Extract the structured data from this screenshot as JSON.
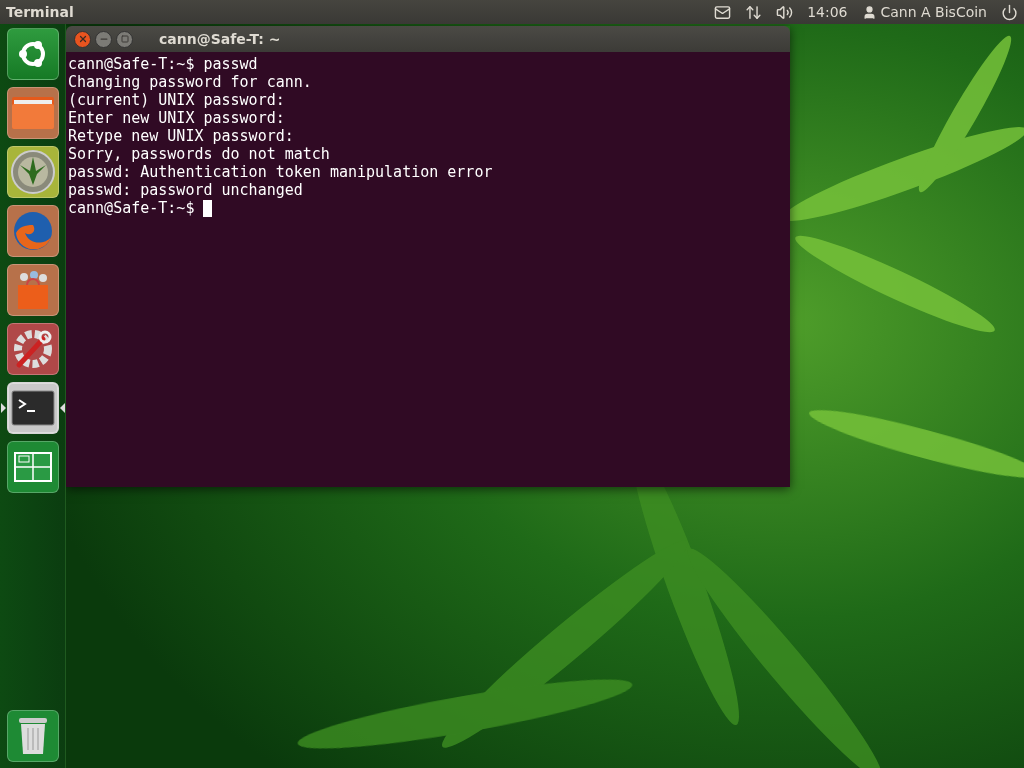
{
  "top_panel": {
    "app_title": "Terminal",
    "clock": "14:06",
    "user": "Cann A BisCoin"
  },
  "launcher": {
    "items": [
      {
        "kind": "ubuntu",
        "selected": false
      },
      {
        "kind": "files",
        "selected": false
      },
      {
        "kind": "coin",
        "selected": false
      },
      {
        "kind": "browser",
        "selected": false
      },
      {
        "kind": "store",
        "selected": false
      },
      {
        "kind": "settings",
        "selected": false
      },
      {
        "kind": "terminal",
        "selected": true
      },
      {
        "kind": "workspaces",
        "selected": false
      }
    ],
    "trash": {
      "kind": "trash"
    }
  },
  "terminal": {
    "title": "cann@Safe-T: ~",
    "cursor": true,
    "lines": [
      "cann@Safe-T:~$ passwd",
      "Changing password for cann.",
      "(current) UNIX password:",
      "Enter new UNIX password:",
      "Retype new UNIX password:",
      "Sorry, passwords do not match",
      "passwd: Authentication token manipulation error",
      "passwd: password unchanged",
      "cann@Safe-T:~$ "
    ]
  }
}
